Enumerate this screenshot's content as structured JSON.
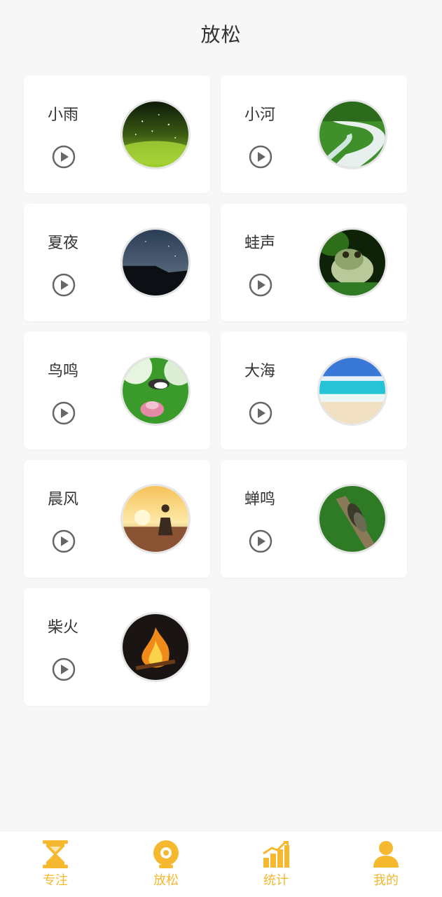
{
  "page": {
    "title": "放松"
  },
  "sounds": [
    {
      "name": "小雨",
      "icon": "rain-image"
    },
    {
      "name": "小河",
      "icon": "river-image"
    },
    {
      "name": "夏夜",
      "icon": "summer-night-image"
    },
    {
      "name": "蛙声",
      "icon": "frog-image"
    },
    {
      "name": "鸟鸣",
      "icon": "bird-image"
    },
    {
      "name": "大海",
      "icon": "sea-image"
    },
    {
      "name": "晨风",
      "icon": "morning-breeze-image"
    },
    {
      "name": "蝉鸣",
      "icon": "cicada-image"
    },
    {
      "name": "柴火",
      "icon": "campfire-image"
    }
  ],
  "tabbar": {
    "accent_color": "#f5b82e",
    "items": [
      {
        "label": "专注",
        "icon": "hourglass-icon"
      },
      {
        "label": "放松",
        "icon": "relax-disc-icon"
      },
      {
        "label": "统计",
        "icon": "bar-chart-icon"
      },
      {
        "label": "我的",
        "icon": "user-icon"
      }
    ]
  }
}
